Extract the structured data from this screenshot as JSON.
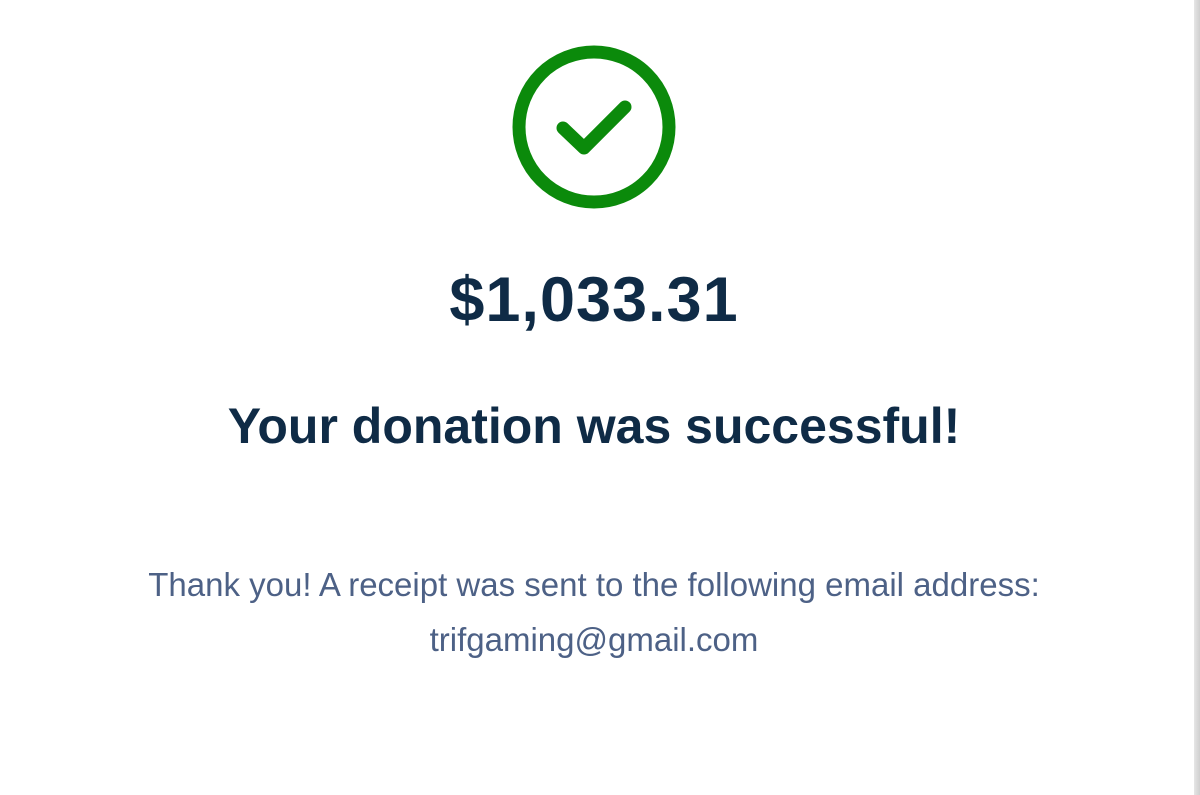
{
  "status": {
    "icon": "check-circle-icon",
    "color": "#0b8a0b"
  },
  "donation": {
    "amount": "$1,033.31",
    "headline": "Your donation was successful!"
  },
  "receipt": {
    "message": "Thank you! A receipt was sent to the following email address:",
    "email": "trifgaming@gmail.com"
  },
  "colors": {
    "heading": "#0f2b46",
    "body_text": "#4d6186",
    "success": "#0b8a0b"
  }
}
